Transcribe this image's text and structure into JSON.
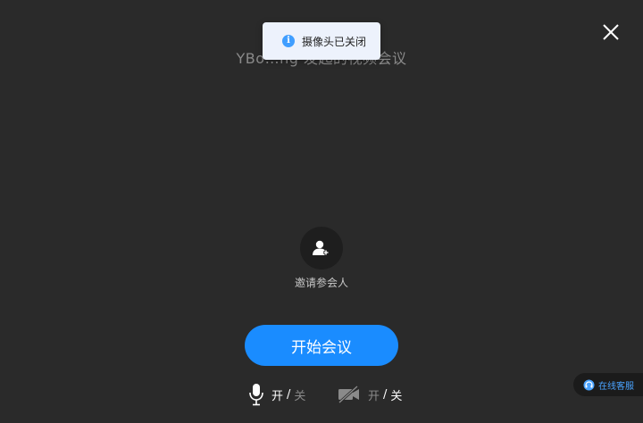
{
  "meeting": {
    "title": "YBo…ng 发起的视频会议"
  },
  "toast": {
    "icon": "info-icon",
    "message": "摄像头已关闭"
  },
  "close": {
    "icon": "close-icon"
  },
  "invite": {
    "icon": "add-user-icon",
    "label": "邀请参会人"
  },
  "start": {
    "label": "开始会议",
    "color": "#1a8cff"
  },
  "mic": {
    "icon": "microphone-icon",
    "on_label": "开",
    "separator": "/",
    "off_label": "关",
    "state": "on"
  },
  "camera": {
    "icon": "camera-off-icon",
    "on_label": "开",
    "separator": "/",
    "off_label": "关",
    "state": "off"
  },
  "support": {
    "icon": "headset-icon",
    "label": "在线客服"
  },
  "colors": {
    "background": "#2a2a2a",
    "accent": "#1a8cff",
    "toast_bg": "#edf2fc"
  }
}
